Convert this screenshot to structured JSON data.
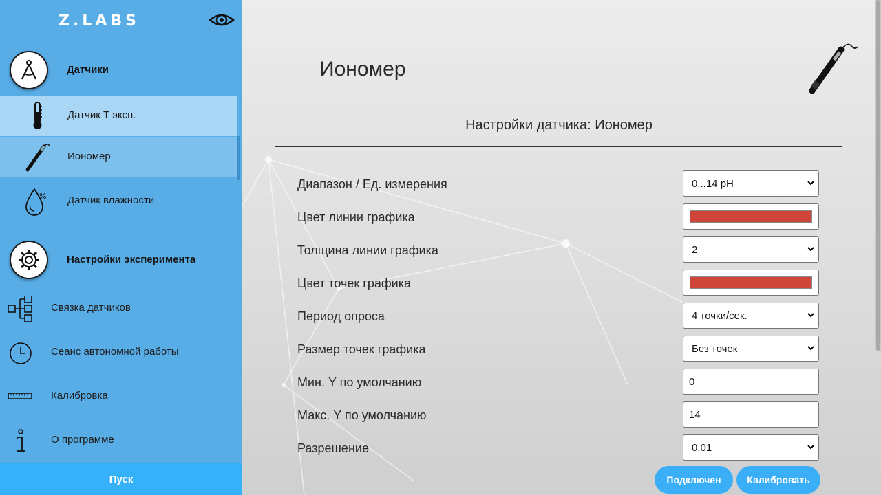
{
  "app": {
    "logo": "Z.LABS"
  },
  "sidebar": {
    "sections": [
      {
        "title": "Датчики",
        "icon": "calipers-icon"
      },
      {
        "title": "Настройки эксперимента",
        "icon": "gear-icon"
      }
    ],
    "sensors": [
      {
        "label": "Датчик Т эксп.",
        "icon": "thermometer-icon"
      },
      {
        "label": "Иономер",
        "icon": "ph-probe-icon"
      },
      {
        "label": "Датчик влажности",
        "icon": "humidity-drop-icon"
      }
    ],
    "settings": [
      {
        "label": "Связка датчиков",
        "icon": "flowchart-icon"
      },
      {
        "label": "Сеанс автономной работы",
        "icon": "clock-icon"
      },
      {
        "label": "Калибровка",
        "icon": "ruler-icon"
      },
      {
        "label": "О программе",
        "icon": "info-icon"
      }
    ],
    "start_label": "Пуск"
  },
  "main": {
    "title": "Иономер",
    "subtitle": "Настройки датчика: Иономер",
    "fields": [
      {
        "label": "Диапазон / Ед. измерения",
        "type": "select",
        "value": "0...14 pH"
      },
      {
        "label": "Цвет линии графика",
        "type": "color",
        "value": "#d0453a"
      },
      {
        "label": "Толщина линии графика",
        "type": "select",
        "value": "2"
      },
      {
        "label": "Цвет точек графика",
        "type": "color",
        "value": "#d0453a"
      },
      {
        "label": "Период опроса",
        "type": "select",
        "value": "4 точки/сек."
      },
      {
        "label": "Размер точек графика",
        "type": "select",
        "value": "Без точек"
      },
      {
        "label": "Мин. Y по умолчанию",
        "type": "input",
        "value": "0"
      },
      {
        "label": "Макс. Y по умолчанию",
        "type": "input",
        "value": "14"
      },
      {
        "label": "Разрешение",
        "type": "select",
        "value": "0.01"
      }
    ],
    "buttons": {
      "connected": "Подключен",
      "calibrate": "Калибровать"
    }
  }
}
